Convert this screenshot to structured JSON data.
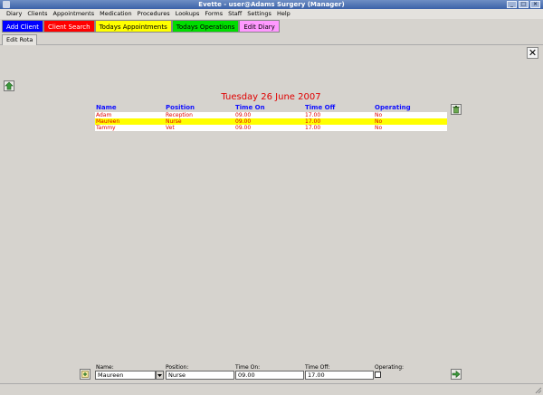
{
  "window": {
    "title": "Evette - user@Adams Surgery (Manager)"
  },
  "menu": [
    "Diary",
    "Clients",
    "Appointments",
    "Medication",
    "Procedures",
    "Lookups",
    "Forms",
    "Staff",
    "Settings",
    "Help"
  ],
  "toolbar": [
    {
      "label": "Add Client",
      "bg": "#0000ff",
      "fg": "#ffffff"
    },
    {
      "label": "Client Search",
      "bg": "#ff0000",
      "fg": "#ffffff"
    },
    {
      "label": "Todays Appointments",
      "bg": "#ffff00",
      "fg": "#000000"
    },
    {
      "label": "Todays Operations",
      "bg": "#00dd00",
      "fg": "#000000"
    },
    {
      "label": "Edit Diary",
      "bg": "#ff99ff",
      "fg": "#000000"
    }
  ],
  "tab": {
    "label": "Edit Rota"
  },
  "rota": {
    "date_title": "Tuesday 26 June 2007",
    "columns": [
      "Name",
      "Position",
      "Time On",
      "Time Off",
      "Operating"
    ],
    "rows": [
      [
        "Adam",
        "Reception",
        "09.00",
        "17.00",
        "No"
      ],
      [
        "Maureen",
        "Nurse",
        "09.00",
        "17.00",
        "No"
      ],
      [
        "Tammy",
        "Vet",
        "09.00",
        "17.00",
        "No"
      ]
    ],
    "selected_row": 1
  },
  "form": {
    "name_label": "Name:",
    "name_value": "Maureen",
    "position_label": "Position:",
    "position_value": "Nurse",
    "timeon_label": "Time On:",
    "timeon_value": "09.00",
    "timeoff_label": "Time Off:",
    "timeoff_value": "17.00",
    "operating_label": "Operating:",
    "operating_checked": false
  },
  "colors": {
    "title_red": "#e00000",
    "header_blue": "#1010ff",
    "selected_row": "#ffff00"
  }
}
